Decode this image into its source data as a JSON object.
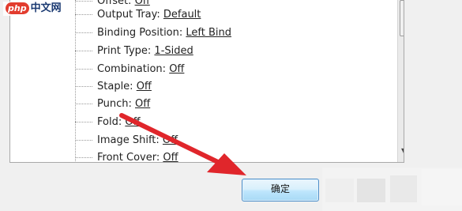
{
  "tree": {
    "items": [
      {
        "label": "Offset: ",
        "value": "Off"
      },
      {
        "label": "Output Tray: ",
        "value": "Default"
      },
      {
        "label": "Binding Position: ",
        "value": "Left Bind"
      },
      {
        "label": "Print Type: ",
        "value": "1-Sided"
      },
      {
        "label": "Combination: ",
        "value": "Off"
      },
      {
        "label": "Staple: ",
        "value": "Off"
      },
      {
        "label": "Punch: ",
        "value": "Off"
      },
      {
        "label": "Fold: ",
        "value": "Off"
      },
      {
        "label": "Image Shift: ",
        "value": "Off"
      },
      {
        "label": "Front Cover: ",
        "value": "Off"
      }
    ]
  },
  "dialog": {
    "ok_label": "确定"
  },
  "watermark": {
    "brand_badge": "php",
    "site": "中文网"
  },
  "annotation": {
    "arrow_color": "#e0262b"
  }
}
